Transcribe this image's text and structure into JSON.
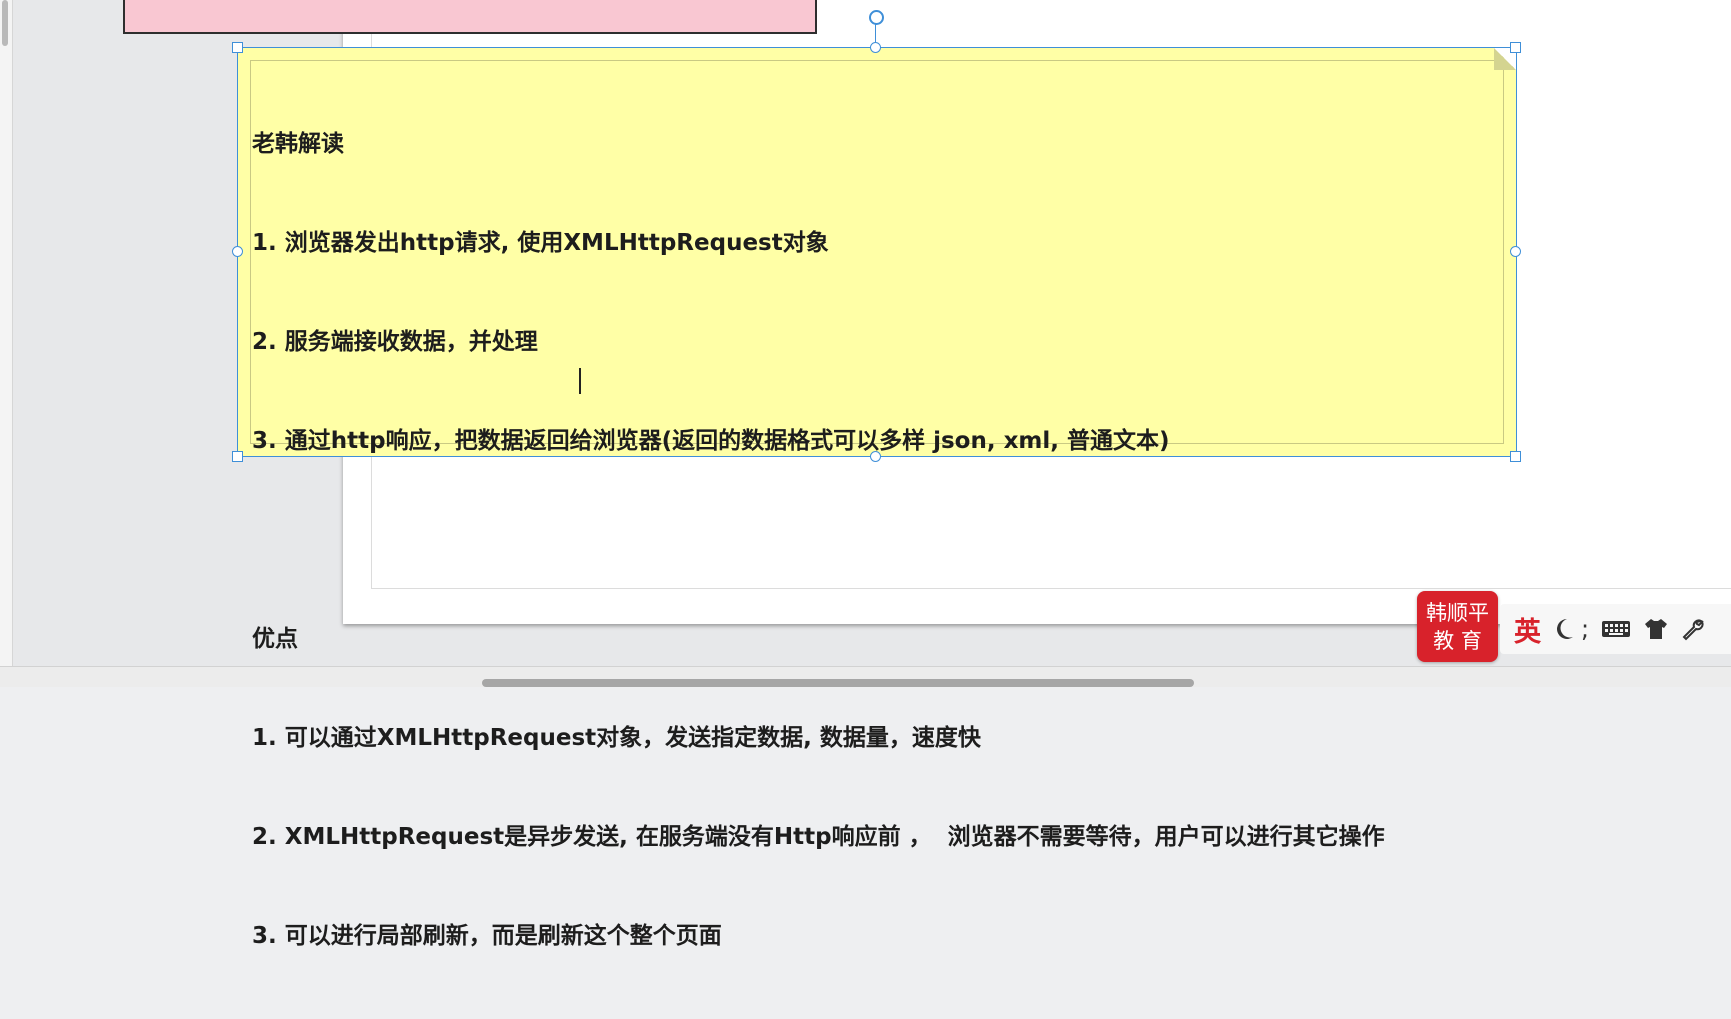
{
  "note": {
    "lines": [
      "老韩解读",
      "1. 浏览器发出http请求, 使用XMLHttpRequest对象",
      "2. 服务端接收数据，并处理",
      "3. 通过http响应，把数据返回给浏览器(返回的数据格式可以多样 json, xml, 普通文本)",
      "",
      "优点",
      "1. 可以通过XMLHttpRequest对象，发送指定数据, 数据量，速度快",
      "2. XMLHttpRequest是异步发送, 在服务端没有Http响应前 ，  浏览器不需要等待，用户可以进行其它操作",
      "3. 可以进行局部刷新，而是刷新这个整个页面"
    ]
  },
  "logo": {
    "line1": "韩顺平",
    "line2": "教 育"
  },
  "ime": {
    "language": "英",
    "punctuation": ";",
    "icons": [
      "moon-icon",
      "keyboard-icon",
      "shirt-icon",
      "wrench-icon"
    ]
  }
}
